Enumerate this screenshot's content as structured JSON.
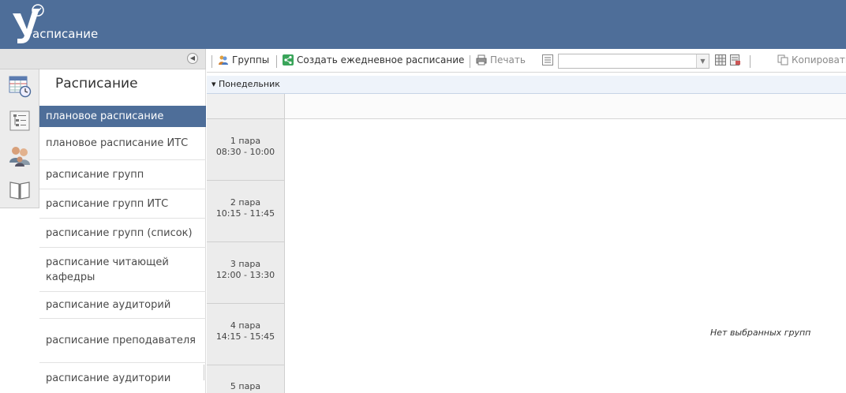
{
  "app": {
    "title": "Расписание"
  },
  "menu": {
    "title": "Расписание",
    "items": [
      {
        "label": "плановое расписание",
        "active": true
      },
      {
        "label": "плановое расписание ИТС",
        "active": false
      },
      {
        "label": "расписание групп",
        "active": false
      },
      {
        "label": "расписание групп ИТС",
        "active": false
      },
      {
        "label": "расписание групп (список)",
        "active": false
      },
      {
        "label": "расписание читающей кафедры",
        "active": false
      },
      {
        "label": "расписание аудиторий",
        "active": false
      },
      {
        "label": "расписание преподавателя",
        "active": false
      },
      {
        "label": "расписание аудитории",
        "active": false
      }
    ]
  },
  "icon_strip": [
    "schedule-clock-icon",
    "tree-list-icon",
    "users-group-icon",
    "book-icon"
  ],
  "toolbar": {
    "groups_label": "Группы",
    "create_daily_label": "Создать ежедневное расписание",
    "print_label": "Печать",
    "copy_label": "Копировать",
    "combo_value": ""
  },
  "day": {
    "label": "Понедельник"
  },
  "slots": [
    {
      "name": "1 пара",
      "time": "08:30 - 10:00"
    },
    {
      "name": "2 пара",
      "time": "10:15 - 11:45"
    },
    {
      "name": "3 пара",
      "time": "12:00 - 13:30"
    },
    {
      "name": "4 пара",
      "time": "14:15 - 15:45"
    },
    {
      "name": "5 пара",
      "time": ""
    }
  ],
  "empty_message": "Нет выбранных групп",
  "colors": {
    "header": "#4e6e99",
    "active_item": "#4e6e99",
    "strip": "#ececec"
  }
}
